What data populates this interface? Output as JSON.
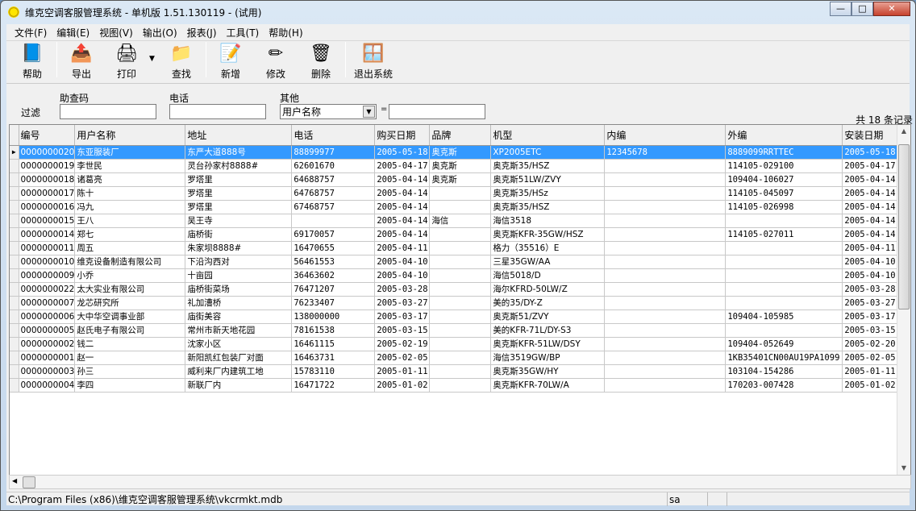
{
  "title": "维克空调客服管理系统 - 单机版 1.51.130119 - (试用)",
  "window_controls": {
    "minimize": "—",
    "maximize": "□",
    "close": "✕"
  },
  "menu": [
    "文件(F)",
    "编辑(E)",
    "视图(V)",
    "输出(O)",
    "报表(J)",
    "工具(T)",
    "帮助(H)"
  ],
  "toolbar": [
    {
      "label": "帮助",
      "icon": "help-book-icon",
      "glyph": "📘"
    },
    {
      "label": "导出",
      "icon": "export-icon",
      "glyph": "📤"
    },
    {
      "label": "打印",
      "icon": "print-icon",
      "glyph": "🖨"
    },
    {
      "label": "查找",
      "icon": "folder-search-icon",
      "glyph": "📁"
    },
    {
      "label": "新增",
      "icon": "new-document-icon",
      "glyph": "📝"
    },
    {
      "label": "修改",
      "icon": "edit-pencil-icon",
      "glyph": "✏"
    },
    {
      "label": "删除",
      "icon": "recycle-bin-icon",
      "glyph": "🗑"
    },
    {
      "label": "退出系统",
      "icon": "exit-windows-icon",
      "glyph": "🪟"
    }
  ],
  "filter": {
    "label": "过滤",
    "helpcode_label": "助查码",
    "helpcode_value": "",
    "phone_label": "电话",
    "phone_value": "",
    "other_label": "其他",
    "other_selected": "用户名称",
    "equals": "=",
    "other_value": "",
    "record_count": "共 18 条记录"
  },
  "table": {
    "columns": [
      "编号",
      "用户名称",
      "地址",
      "电话",
      "购买日期",
      "品牌",
      "机型",
      "内编",
      "外编",
      "安装日期"
    ],
    "selected_row": 0,
    "rows": [
      [
        "0000000020",
        "东亚服装厂",
        "东严大道888号",
        "88899977",
        "2005-05-18",
        "奥克斯",
        "XP2005ETC",
        "12345678",
        "8889099RRTTEC",
        "2005-05-18"
      ],
      [
        "0000000019",
        "李世民",
        "灵台孙家村8888#",
        "62601670",
        "2005-04-17",
        "奥克斯",
        "奥克斯35/HSZ",
        "",
        "114105-029100",
        "2005-04-17"
      ],
      [
        "0000000018",
        "诸葛亮",
        "罗塔里",
        "64688757",
        "2005-04-14",
        "奥克斯",
        "奥克斯51LW/ZVY",
        "",
        "109404-106027",
        "2005-04-14"
      ],
      [
        "0000000017",
        "陈十",
        "罗塔里",
        "64768757",
        "2005-04-14",
        "",
        "奥克斯35/HSz",
        "",
        "114105-045097",
        "2005-04-14"
      ],
      [
        "0000000016",
        "冯九",
        "罗塔里",
        "67468757",
        "2005-04-14",
        "",
        "奥克斯35/HSZ",
        "",
        "114105-026998",
        "2005-04-14"
      ],
      [
        "0000000015",
        "王八",
        "吴王寺",
        "",
        "2005-04-14",
        "海信",
        "海信3518",
        "",
        "",
        "2005-04-14"
      ],
      [
        "0000000014",
        "郑七",
        "庙桥街",
        "69170057",
        "2005-04-14",
        "",
        "奥克斯KFR-35GW/HSZ",
        "",
        "114105-027011",
        "2005-04-14"
      ],
      [
        "0000000011",
        "周五",
        "朱家坝8888#",
        "16470655",
        "2005-04-11",
        "",
        "格力（35516）E",
        "",
        "",
        "2005-04-11"
      ],
      [
        "0000000010",
        "维克设备制造有限公司",
        "下沿沟西对",
        "56461553",
        "2005-04-10",
        "",
        "三星35GW/AA",
        "",
        "",
        "2005-04-10"
      ],
      [
        "0000000009",
        "小乔",
        "十亩园",
        "36463602",
        "2005-04-10",
        "",
        "海信5018/D",
        "",
        "",
        "2005-04-10"
      ],
      [
        "0000000022",
        "太大实业有限公司",
        "庙桥街菜场",
        "76471207",
        "2005-03-28",
        "",
        "海尔KFRD-50LW/Z",
        "",
        "",
        "2005-03-28"
      ],
      [
        "0000000007",
        "龙芯研究所",
        "礼加漕桥",
        "76233407",
        "2005-03-27",
        "",
        "美的35/DY-Z",
        "",
        "",
        "2005-03-27"
      ],
      [
        "0000000006",
        "大中华空调事业部",
        "庙街美容",
        "138000000",
        "2005-03-17",
        "",
        "奥克斯51/ZVY",
        "",
        "109404-105985",
        "2005-03-17"
      ],
      [
        "0000000005",
        "赵氏电子有限公司",
        "常州市新天地花园",
        "78161538",
        "2005-03-15",
        "",
        "美的KFR-71L/DY-S3",
        "",
        "",
        "2005-03-15"
      ],
      [
        "0000000002",
        "钱二",
        "沈家小区",
        "16461115",
        "2005-02-19",
        "",
        "奥克斯KFR-51LW/DSY",
        "",
        "109404-052649",
        "2005-02-20"
      ],
      [
        "0000000001",
        "赵一",
        "新阳凯红包装厂对面",
        "16463731",
        "2005-02-05",
        "",
        "海信3519GW/BP",
        "",
        "1KB35401CN00AU19PA1099",
        "2005-02-05"
      ],
      [
        "0000000003",
        "孙三",
        "威利来厂内建筑工地",
        "15783110",
        "2005-01-11",
        "",
        "奥克斯35GW/HY",
        "",
        "103104-154286",
        "2005-01-11"
      ],
      [
        "0000000004",
        "李四",
        "新联厂内",
        "16471722",
        "2005-01-02",
        "",
        "奥克斯KFR-70LW/A",
        "",
        "170203-007428",
        "2005-01-02"
      ]
    ]
  },
  "status": {
    "path": "C:\\Program Files (x86)\\维克空调客服管理系统\\vkcrmkt.mdb",
    "user": "sa"
  }
}
